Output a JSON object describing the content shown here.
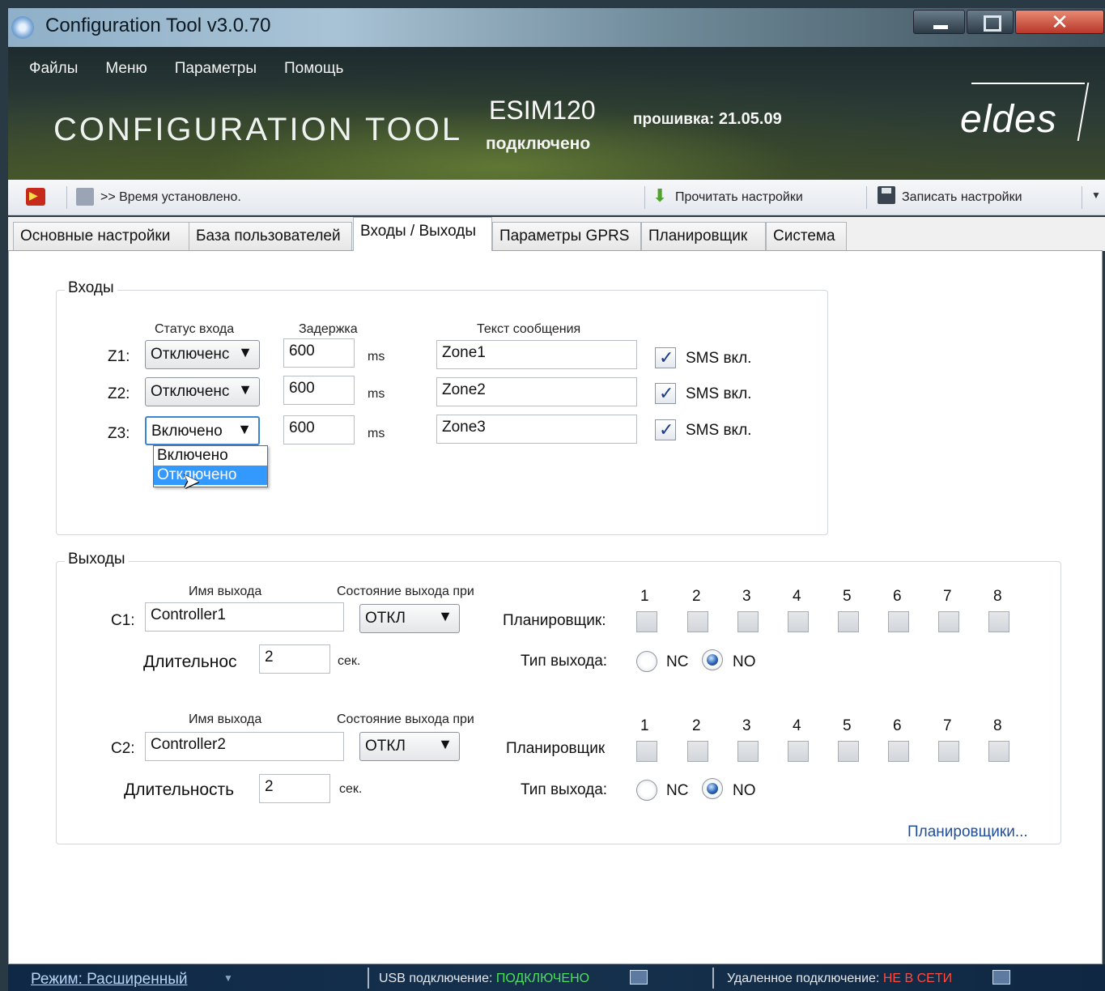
{
  "window": {
    "title": "Configuration Tool v3.0.70"
  },
  "menu": [
    "Файлы",
    "Меню",
    "Параметры",
    "Помощь"
  ],
  "banner": {
    "logo_text": "CONFIGURATION TOOL",
    "device": "ESIM120",
    "firmware_label": "прошивка:",
    "firmware_version": "21.05.09",
    "connection_state": "подключено",
    "brand": "eldes"
  },
  "toolbar": {
    "status": ">> Время установлено.",
    "read_label": "Прочитать настройки",
    "write_label": "Записать настройки"
  },
  "tabs": [
    {
      "label": "Основные настройки",
      "active": false
    },
    {
      "label": "База пользователей",
      "active": false
    },
    {
      "label": "Входы / Выходы",
      "active": true
    },
    {
      "label": "Параметры GPRS",
      "active": false
    },
    {
      "label": "Планировщик",
      "active": false
    },
    {
      "label": "Система",
      "active": false
    }
  ],
  "inputs": {
    "title": "Входы",
    "col_status": "Статус входа",
    "col_delay": "Задержка",
    "col_text": "Текст сообщения",
    "delay_unit": "ms",
    "sms_label": "SMS вкл.",
    "rows": [
      {
        "label": "Z1:",
        "status": "Отключенс",
        "delay": "600",
        "text": "Zone1",
        "sms": true
      },
      {
        "label": "Z2:",
        "status": "Отключенс",
        "delay": "600",
        "text": "Zone2",
        "sms": true
      },
      {
        "label": "Z3:",
        "status": "Включено",
        "delay": "600",
        "text": "Zone3",
        "sms": true
      }
    ],
    "dropdown_options": [
      "Включено",
      "Отключено"
    ],
    "dropdown_selected": "Отключено"
  },
  "outputs": {
    "title": "Выходы",
    "col_name": "Имя выхода",
    "col_state": "Состояние выхода при",
    "scheduler_numbers": [
      "1",
      "2",
      "3",
      "4",
      "5",
      "6",
      "7",
      "8"
    ],
    "type_label": "Тип выхода:",
    "nc": "NC",
    "no": "NO",
    "sec_unit": "сек.",
    "rows": [
      {
        "label": "C1:",
        "name": "Controller1",
        "state": "ОТКЛ",
        "scheduler_label": "Планировщик:",
        "duration_label": "Длительнос",
        "duration": "2",
        "type": "NO"
      },
      {
        "label": "C2:",
        "name": "Controller2",
        "state": "ОТКЛ",
        "scheduler_label": "Планировщик",
        "duration_label": "Длительность",
        "duration": "2",
        "type": "NO"
      }
    ],
    "schedulers_link": "Планировщики..."
  },
  "statusbar": {
    "mode": "Режим: Расширенный",
    "usb_label": "USB подключение:",
    "usb_value": "ПОДКЛЮЧЕНО",
    "remote_label": "Удаленное подключение:",
    "remote_value": "НЕ В СЕТИ"
  },
  "colors": {
    "accent": "#3399ff",
    "usb_connected": "#49e05a",
    "remote_offline": "#ff4a3d",
    "link": "#1e4e9c"
  }
}
